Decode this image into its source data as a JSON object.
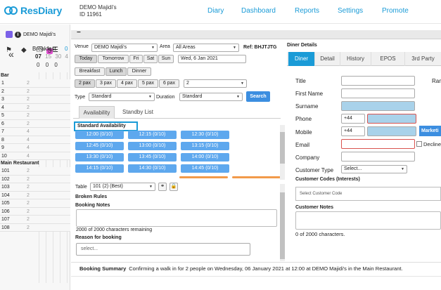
{
  "app": {
    "logo_text": "ResDiary",
    "venue_line1": "DEMO Majidi's",
    "venue_line2": "ID 11961"
  },
  "nav": [
    "Diary",
    "Dashboard",
    "Reports",
    "Settings",
    "Promote"
  ],
  "rail": {
    "venue": "DEMO Majidi's",
    "badge": "5",
    "meal": "Breakfast",
    "meal_extra": "0",
    "time_current": "07",
    "time_next": [
      "15",
      "30",
      "4"
    ],
    "counts": [
      "0",
      "0",
      "0"
    ],
    "sections": [
      {
        "name": "Bar",
        "tables": [
          {
            "n": "1",
            "c": "2"
          },
          {
            "n": "2",
            "c": "2"
          },
          {
            "n": "3",
            "c": "2"
          },
          {
            "n": "4",
            "c": "2"
          },
          {
            "n": "5",
            "c": "2"
          },
          {
            "n": "6",
            "c": "2"
          },
          {
            "n": "7",
            "c": "4"
          },
          {
            "n": "8",
            "c": "4"
          },
          {
            "n": "9",
            "c": "4"
          },
          {
            "n": "10",
            "c": "4"
          }
        ]
      },
      {
        "name": "Main Restaurant",
        "tables": [
          {
            "n": "101",
            "c": "2"
          },
          {
            "n": "102",
            "c": "2"
          },
          {
            "n": "103",
            "c": "2"
          },
          {
            "n": "104",
            "c": "2"
          },
          {
            "n": "105",
            "c": "2"
          },
          {
            "n": "106",
            "c": "2"
          },
          {
            "n": "107",
            "c": "2"
          },
          {
            "n": "108",
            "c": "2"
          }
        ]
      }
    ]
  },
  "panel": {
    "collapse": "−"
  },
  "booking": {
    "venue_label": "Venue",
    "venue_value": "DEMO Majidi's",
    "area_label": "Area",
    "area_value": "All Areas",
    "ref": "Ref: BHJTJTG",
    "date_buttons": [
      "Today",
      "Tomorrow",
      "Fri",
      "Sat",
      "Sun"
    ],
    "date_value": "Wed, 6 Jan 2021",
    "meal_buttons": [
      "Breakfast",
      "Lunch",
      "Dinner"
    ],
    "pax_buttons": [
      "2 pax",
      "3 pax",
      "4 pax",
      "5 pax",
      "6 pax"
    ],
    "pax_value": "2",
    "type_label": "Type",
    "type_value": "Standard",
    "duration_label": "Duration",
    "duration_value": "Standard",
    "search": "Search",
    "tabs": [
      "Availability",
      "Standby List"
    ],
    "standard_availability": "Standard Availability",
    "slots": [
      "12:00 (0/10)",
      "12:15 (0/10)",
      "12:30 (0/10)",
      "12:45 (0/10)",
      "13:00 (0/10)",
      "13:15 (0/10)",
      "13:30 (0/10)",
      "13:45 (0/10)",
      "14:00 (0/10)",
      "14:15 (0/10)",
      "14:30 (0/10)",
      "14:45 (0/10)"
    ],
    "table_label": "Table",
    "table_value": "101 (2) (Best)",
    "broken_rules": "Broken Rules",
    "booking_notes": "Booking Notes",
    "chars_remaining": "2000 of 2000 characters remaining",
    "reason_label": "Reason for booking",
    "reason_placeholder": "select..."
  },
  "diner": {
    "header": "Diner Details",
    "tabs": [
      "Diner",
      "Detail",
      "History",
      "EPOS",
      "3rd Party"
    ],
    "fields": {
      "title": "Title",
      "rank": "Ran",
      "first_name": "First Name",
      "surname": "Surname",
      "phone": "Phone",
      "phone_code": "+44",
      "mobile": "Mobile",
      "mobile_code": "+44",
      "marketing": "Marketi",
      "email": "Email",
      "declined": "Decline",
      "company": "Company",
      "customer_type": "Customer Type",
      "customer_type_value": "Select..."
    },
    "codes_label": "Customer Codes (Interests)",
    "codes_placeholder": "Select Customer Code",
    "notes_label": "Customer Notes",
    "notes_count": "0 of 2000 characters."
  },
  "summary": {
    "label": "Booking Summary",
    "text": "Confirming a walk in for 2 people on Wednesday, 06 January 2021 at 12:00 at DEMO Majidi's in the Main Restaurant."
  }
}
